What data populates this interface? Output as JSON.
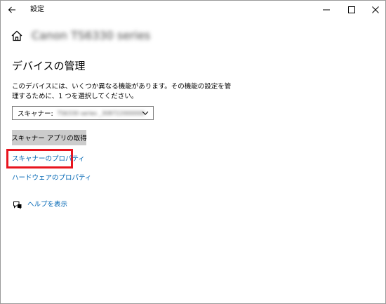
{
  "window": {
    "title": "設定"
  },
  "header": {
    "device_name": "Canon TS6330 series",
    "home_icon": "home-icon"
  },
  "section": {
    "title": "デバイスの管理",
    "description": "このデバイスには、いくつか異なる機能があります。その機能の設定を管理するために、1 つを選択してください。"
  },
  "scanner_select": {
    "label": "スキャナー:",
    "value": "TS6330 series _308722000000"
  },
  "buttons": {
    "get_scanner_app": "スキャナー アプリの取得"
  },
  "links": {
    "scanner_properties": "スキャナーのプロパティ",
    "hardware_properties": "ハードウェアのプロパティ",
    "help": "ヘルプを表示"
  },
  "colors": {
    "link": "#0066b4",
    "highlight": "#e8141e",
    "button_bg": "#cccccc"
  }
}
